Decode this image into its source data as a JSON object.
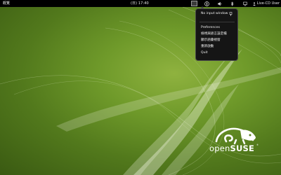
{
  "top_panel": {
    "activities_label": "概覽",
    "clock": "(日) 17:40",
    "user_name": "Live-CD User",
    "icons": [
      "keyboard-indicator-icon",
      "accessibility-icon",
      "volume-icon",
      "bluetooth-icon",
      "network-icon",
      "user-icon"
    ]
  },
  "input_method_menu": {
    "header": "No input window",
    "items": [
      "Preferences",
      "檢視與語言設定檔",
      "顯示語彙視窗",
      "重新啟動",
      "Quit"
    ]
  },
  "wallpaper": {
    "logo_text_open": "open",
    "logo_text_suse": "SUSE",
    "logo_trademark": "®",
    "colors": {
      "background_light": "#8fb23f",
      "background_dark": "#3a5a12",
      "panel": "#000000",
      "menu_bg": "#151515"
    }
  }
}
